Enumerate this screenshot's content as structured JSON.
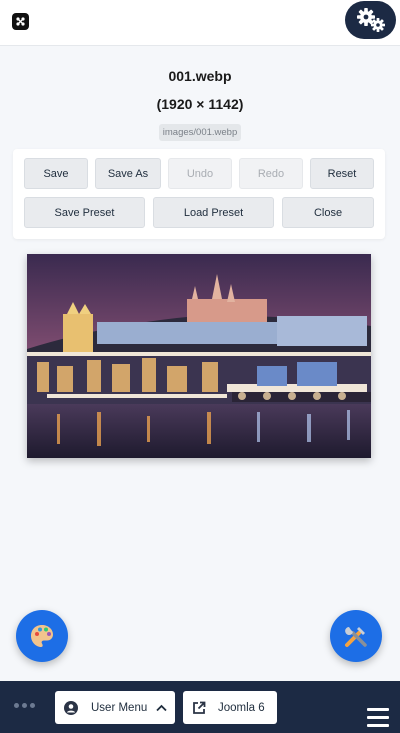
{
  "header": {
    "logo_icon": "joomla-logo-icon",
    "settings_icon": "gears-icon"
  },
  "image_info": {
    "filename": "001.webp",
    "dimensions": "(1920 × 1142)",
    "path": "images/001.webp"
  },
  "toolbar": {
    "save": "Save",
    "save_as": "Save As",
    "undo": "Undo",
    "redo": "Redo",
    "reset": "Reset",
    "save_preset": "Save Preset",
    "load_preset": "Load Preset",
    "close": "Close",
    "disabled": [
      "Undo",
      "Redo"
    ]
  },
  "fabs": {
    "left_icon": "palette-icon",
    "right_icon": "tools-icon"
  },
  "footer": {
    "user_menu": "User Menu",
    "site_link": "Joomla 6",
    "accent_color": "#1d6ee6",
    "bar_color": "#1c2a44"
  }
}
